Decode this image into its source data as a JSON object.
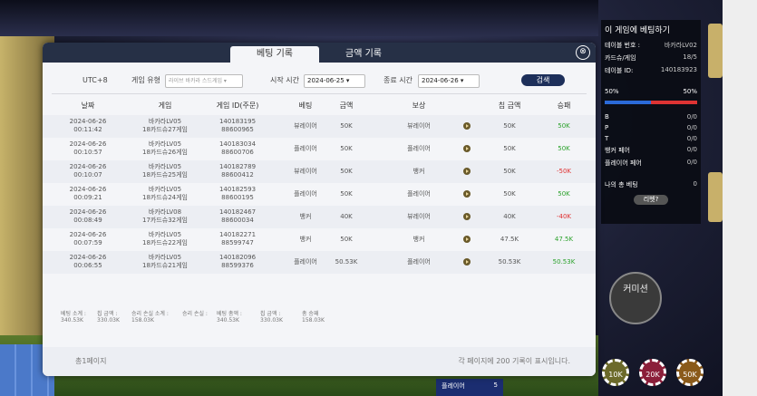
{
  "modal": {
    "tabs": [
      "베팅 기록",
      "금액 기록"
    ],
    "close_label": "⊗",
    "filters": {
      "timezone": "UTC+8",
      "game_type_label": "게임 유형",
      "game_type_value": "라이브 바카라 스드게임",
      "start_label": "시작 시간",
      "start_value": "2024-06-25",
      "end_label": "종료 시간",
      "end_value": "2024-06-26",
      "search": "검색"
    },
    "headers": [
      "날짜",
      "게임",
      "게임 ID(주문)",
      "베팅",
      "금액",
      "보상",
      "칩 금액",
      "승패"
    ],
    "rows": [
      {
        "date": "2024-06-26",
        "time": "00:11:42",
        "game1": "바카라LV05",
        "game2": "18카드슈27게임",
        "id1": "140183195",
        "id2": "88600965",
        "bet": "뷰레이어",
        "amount": "50K",
        "reward": "뷰레이어",
        "chip": "50K",
        "result": "50K",
        "color": "#2aa12a"
      },
      {
        "date": "2024-06-26",
        "time": "00:10:57",
        "game1": "바카라LV05",
        "game2": "18카드슈26게임",
        "id1": "140183034",
        "id2": "88600706",
        "bet": "플레이어",
        "amount": "50K",
        "reward": "플레이어",
        "chip": "50K",
        "result": "50K",
        "color": "#2aa12a"
      },
      {
        "date": "2024-06-26",
        "time": "00:10:07",
        "game1": "바카라LV05",
        "game2": "18카드슈25게임",
        "id1": "140182789",
        "id2": "88600412",
        "bet": "뷰레이어",
        "amount": "50K",
        "reward": "뱅커",
        "chip": "50K",
        "result": "-50K",
        "color": "#e03030"
      },
      {
        "date": "2024-06-26",
        "time": "00:09:21",
        "game1": "바카라LV05",
        "game2": "18카드슈24게임",
        "id1": "140182593",
        "id2": "88600195",
        "bet": "플레이어",
        "amount": "50K",
        "reward": "플레이어",
        "chip": "50K",
        "result": "50K",
        "color": "#2aa12a"
      },
      {
        "date": "2024-06-26",
        "time": "00:08:49",
        "game1": "바카라LV08",
        "game2": "17카드슈32게임",
        "id1": "140182467",
        "id2": "88600034",
        "bet": "뱅커",
        "amount": "40K",
        "reward": "뷰레이어",
        "chip": "40K",
        "result": "-40K",
        "color": "#e03030"
      },
      {
        "date": "2024-06-26",
        "time": "00:07:59",
        "game1": "바카라LV05",
        "game2": "18카드슈22게임",
        "id1": "140182271",
        "id2": "88599747",
        "bet": "뱅커",
        "amount": "50K",
        "reward": "뱅커",
        "chip": "47.5K",
        "result": "47.5K",
        "color": "#2aa12a"
      },
      {
        "date": "2024-06-26",
        "time": "00:06:55",
        "game1": "바카라LV05",
        "game2": "18카드슈21게임",
        "id1": "140182096",
        "id2": "88599376",
        "bet": "플레이어",
        "amount": "50.53K",
        "reward": "플레이어",
        "chip": "50.53K",
        "result": "50.53K",
        "color": "#2aa12a"
      }
    ],
    "summary": [
      {
        "label": "베팅 소계 :",
        "value": "340.53K"
      },
      {
        "label": "칩 금액 :",
        "value": "330.03K"
      },
      {
        "label": "승리 손실 소계 :",
        "value": "158.03K"
      },
      {
        "label": "승리 손실 :",
        "value": ""
      },
      {
        "label": "베팅 총액 :",
        "value": "340.53K"
      },
      {
        "label": "칩 금액 :",
        "value": "330.03K"
      },
      {
        "label": "총 승패",
        "value": "158.03K"
      }
    ],
    "footer_left": "총1페이지",
    "footer_right": "각 페이지에 200 기록이 표시입니다."
  },
  "right_panel": {
    "title": "이 게임에 베팅하기",
    "rows": [
      {
        "label": "테이블 번호 :",
        "value": "바카라LV02"
      },
      {
        "label": "카드슈/게임",
        "value": "18/5"
      },
      {
        "label": "테이블 ID:",
        "value": "140183923"
      }
    ],
    "pct_left": "50%",
    "pct_right": "50%",
    "stats": [
      {
        "label": "B",
        "value": "0/0"
      },
      {
        "label": "P",
        "value": "0/0"
      },
      {
        "label": "T",
        "value": "0/0"
      },
      {
        "label": "뱅커 페어",
        "value": "0/0"
      },
      {
        "label": "플레이어 페어",
        "value": "0/0"
      }
    ],
    "total_label": "나의 총 베팅",
    "total_value": "0",
    "button": "리벳?"
  },
  "commission": "커미션",
  "chips": [
    "10K",
    "20K",
    "50K"
  ],
  "bottom_list": {
    "label": "플레이어",
    "value": "5"
  }
}
